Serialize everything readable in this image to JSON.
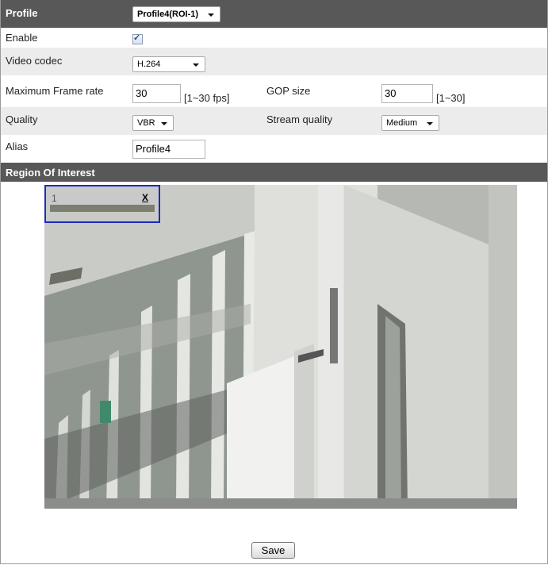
{
  "profile": {
    "label": "Profile",
    "selected": "Profile4(ROI-1)"
  },
  "enable": {
    "label": "Enable",
    "checked": true
  },
  "video_codec": {
    "label": "Video codec",
    "selected": "H.264"
  },
  "max_frame_rate": {
    "label": "Maximum Frame rate",
    "value": "30",
    "range": "[1~30 fps]"
  },
  "gop_size": {
    "label": "GOP size",
    "value": "30",
    "range": "[1~30]"
  },
  "quality": {
    "label": "Quality",
    "selected": "VBR"
  },
  "stream_quality": {
    "label": "Stream quality",
    "selected": "Medium"
  },
  "alias": {
    "label": "Alias",
    "value": "Profile4"
  },
  "roi_section": {
    "title": "Region Of Interest"
  },
  "roi_box": {
    "number": "1",
    "close": "X"
  },
  "save_button": {
    "label": "Save"
  },
  "colors": {
    "header_bg": "#585858",
    "roi_border": "#1c2ac0",
    "alt_row": "#ececec"
  },
  "icons": {
    "checkbox": "checkmark-icon",
    "dropdown": "chevron-down-icon",
    "close": "close-icon"
  }
}
